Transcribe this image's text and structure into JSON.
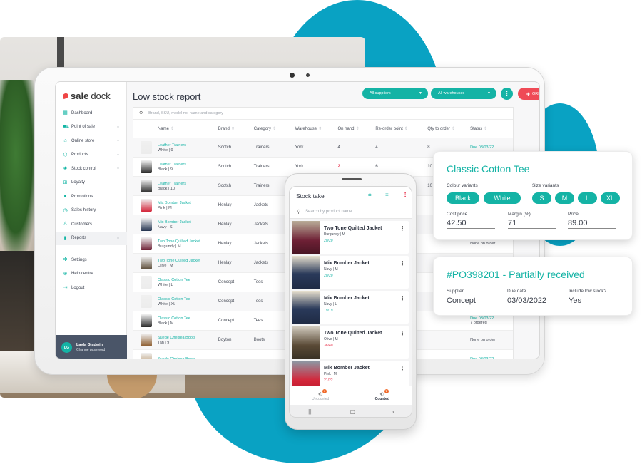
{
  "colors": {
    "accent": "#14b3a5",
    "brand_blue": "#09a2c3",
    "danger": "#ef4a56",
    "sidebar_footer": "#4a5568"
  },
  "app": {
    "logo": {
      "part1": "sale",
      "part2": "dock"
    },
    "sidebar": {
      "items": [
        {
          "label": "Dashboard",
          "icon": "dashboard-icon",
          "chevron": false
        },
        {
          "label": "Point of sale",
          "icon": "cart-icon",
          "chevron": true
        },
        {
          "label": "Online store",
          "icon": "store-icon",
          "chevron": true
        },
        {
          "label": "Products",
          "icon": "tag-icon",
          "chevron": true
        },
        {
          "label": "Stock control",
          "icon": "box-icon",
          "chevron": true
        },
        {
          "label": "Loyalty",
          "icon": "gift-icon",
          "chevron": false
        },
        {
          "label": "Promotions",
          "icon": "promotion-icon",
          "chevron": false
        },
        {
          "label": "Sales history",
          "icon": "history-icon",
          "chevron": false
        },
        {
          "label": "Customers",
          "icon": "user-icon",
          "chevron": false
        },
        {
          "label": "Reports",
          "icon": "bar-chart-icon",
          "chevron": true,
          "active": true
        }
      ],
      "bottom_items": [
        {
          "label": "Settings",
          "icon": "gear-icon"
        },
        {
          "label": "Help centre",
          "icon": "lifebuoy-icon"
        },
        {
          "label": "Logout",
          "icon": "logout-icon"
        }
      ],
      "user": {
        "initials": "LG",
        "name": "Layla Gladwin",
        "sub": "Change password"
      }
    },
    "main": {
      "title": "Low stock report",
      "filters": {
        "supplier": "All suppliers",
        "warehouse": "All warehouses"
      },
      "order_button": "ORDER STOCK",
      "search_placeholder": "Brand, SKU, model no, name and category",
      "columns": [
        "Name",
        "Brand",
        "Category",
        "Warehouse",
        "On hand",
        "Re-order point",
        "Qty to order",
        "Status"
      ],
      "rows": [
        {
          "name": "Leather Trainers",
          "variant": "White | 9",
          "brand": "Scotch",
          "category": "Trainers",
          "warehouse": "York",
          "on_hand": "4",
          "low": false,
          "reorder": "4",
          "qty": "8",
          "status": "Due 03/03/22",
          "status_sub": "",
          "due": true
        },
        {
          "name": "Leather Trainers",
          "variant": "Black | 9",
          "brand": "Scotch",
          "category": "Trainers",
          "warehouse": "York",
          "on_hand": "2",
          "low": true,
          "reorder": "6",
          "qty": "10",
          "status": "",
          "status_sub": "",
          "due": false
        },
        {
          "name": "Leather Trainers",
          "variant": "Black | 10",
          "brand": "Scotch",
          "category": "Trainers",
          "warehouse": "",
          "on_hand": "",
          "low": false,
          "reorder": "",
          "qty": "10",
          "status": "",
          "status_sub": "",
          "due": false
        },
        {
          "name": "Mix Bomber Jacket",
          "variant": "Pink | M",
          "brand": "Henlay",
          "category": "Jackets",
          "warehouse": "",
          "on_hand": "",
          "low": false,
          "reorder": "",
          "qty": "",
          "status": "",
          "status_sub": "",
          "due": false
        },
        {
          "name": "Mix Bomber Jacket",
          "variant": "Navy | S",
          "brand": "Henlay",
          "category": "Jackets",
          "warehouse": "",
          "on_hand": "",
          "low": false,
          "reorder": "",
          "qty": "",
          "status": "",
          "status_sub": "",
          "due": false
        },
        {
          "name": "Two Tone Quilted Jacket",
          "variant": "Burgundy | M",
          "brand": "Henlay",
          "category": "Jackets",
          "warehouse": "",
          "on_hand": "",
          "low": false,
          "reorder": "",
          "qty": "",
          "status": "None on order",
          "status_sub": "",
          "due": false
        },
        {
          "name": "Two Tone Quilted Jacket",
          "variant": "Olive | M",
          "brand": "Henlay",
          "category": "Jackets",
          "warehouse": "",
          "on_hand": "",
          "low": false,
          "reorder": "",
          "qty": "",
          "status": "",
          "status_sub": "",
          "due": false
        },
        {
          "name": "Classic Cotton Tee",
          "variant": "White | L",
          "brand": "Concept",
          "category": "Tees",
          "warehouse": "",
          "on_hand": "",
          "low": false,
          "reorder": "",
          "qty": "",
          "status": "",
          "status_sub": "",
          "due": false
        },
        {
          "name": "Classic Cotton Tee",
          "variant": "White | XL",
          "brand": "Concept",
          "category": "Tees",
          "warehouse": "",
          "on_hand": "",
          "low": false,
          "reorder": "",
          "qty": "",
          "status": "",
          "status_sub": "",
          "due": false
        },
        {
          "name": "Classic Cotton Tee",
          "variant": "Black | M",
          "brand": "Concept",
          "category": "Tees",
          "warehouse": "",
          "on_hand": "",
          "low": false,
          "reorder": "",
          "qty": "",
          "status": "Due 03/03/22",
          "status_sub": "7 ordered",
          "due": true
        },
        {
          "name": "Suede Chelsea Boots",
          "variant": "Tan | 9",
          "brand": "Boyton",
          "category": "Boots",
          "warehouse": "",
          "on_hand": "",
          "low": false,
          "reorder": "",
          "qty": "",
          "status": "None on order",
          "status_sub": "",
          "due": false
        },
        {
          "name": "Suede Chelsea Boots",
          "variant": "",
          "brand": "",
          "category": "",
          "warehouse": "",
          "on_hand": "",
          "low": false,
          "reorder": "",
          "qty": "",
          "status": "Due 03/03/22",
          "status_sub": "",
          "due": true
        }
      ]
    }
  },
  "phone": {
    "title": "Stock take",
    "search_placeholder": "Search by product name",
    "items": [
      {
        "name": "Two Tone Quilted Jacket",
        "variant": "Burgundy | M",
        "count": "20/20",
        "complete": true,
        "img": "burg"
      },
      {
        "name": "Mix Bomber Jacket",
        "variant": "Navy | M",
        "count": "20/20",
        "complete": true,
        "img": "navy"
      },
      {
        "name": "Mix Bomber Jacket",
        "variant": "Navy | L",
        "count": "19/19",
        "complete": true,
        "img": "navy"
      },
      {
        "name": "Two Tone Quilted Jacket",
        "variant": "Olive | M",
        "count": "38/40",
        "complete": false,
        "img": "olive"
      },
      {
        "name": "Mix Bomber Jacket",
        "variant": "Pink | M",
        "count": "21/22",
        "complete": false,
        "img": "pink"
      }
    ],
    "tabs": [
      {
        "label": "Uncounted",
        "badge": "0",
        "active": false
      },
      {
        "label": "Counted",
        "badge": "7",
        "active": true
      }
    ]
  },
  "product_card": {
    "title": "Classic Cotton Tee",
    "colour_label": "Colour variants",
    "colours": [
      "Black",
      "White"
    ],
    "size_label": "Size variants",
    "sizes": [
      "S",
      "M",
      "L",
      "XL"
    ],
    "cost_label": "Cost price",
    "cost": "42.50",
    "margin_label": "Margin (%)",
    "margin": "71",
    "price_label": "Price",
    "price": "89.00"
  },
  "po_card": {
    "title": "#PO398201 - Partially received",
    "supplier_label": "Supplier",
    "supplier": "Concept",
    "due_label": "Due date",
    "due": "03/03/2022",
    "low_label": "Include low stock?",
    "low": "Yes"
  }
}
